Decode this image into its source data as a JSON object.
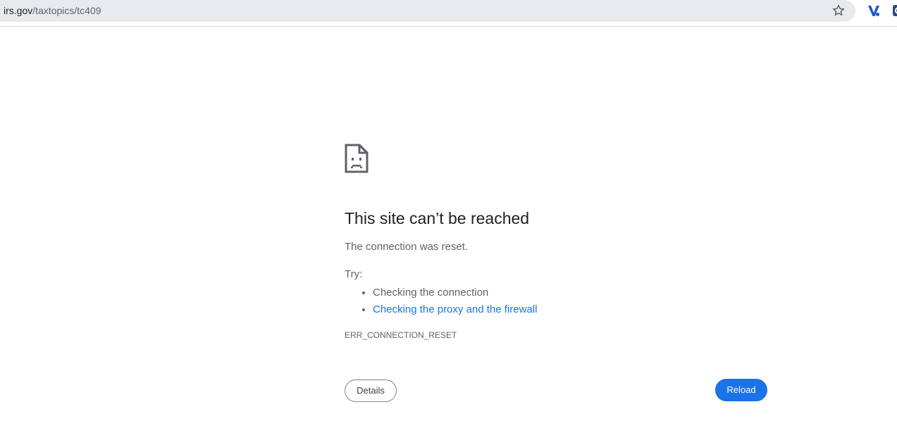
{
  "browser": {
    "url_host": "irs.gov",
    "url_path": "/taxtopics/tc409",
    "icons": {
      "info": "info-icon",
      "bookmark": "star-outline-icon",
      "extension_1": "v-extension-icon",
      "extension_2": "extension-icon"
    }
  },
  "error": {
    "icon": "sad-page-icon",
    "headline": "This site can’t be reached",
    "message": "The connection was reset.",
    "try_label": "Try:",
    "suggestions": [
      {
        "label": "Checking the connection",
        "link": false
      },
      {
        "label": "Checking the proxy and the firewall",
        "link": true
      }
    ],
    "code": "ERR_CONNECTION_RESET"
  },
  "buttons": {
    "details_label": "Details",
    "reload_label": "Reload"
  },
  "colors": {
    "link": "#1a73e8",
    "primary_button": "#1a73e8",
    "text_secondary": "#5f6368",
    "omnibox_bg": "#e8eaed"
  }
}
